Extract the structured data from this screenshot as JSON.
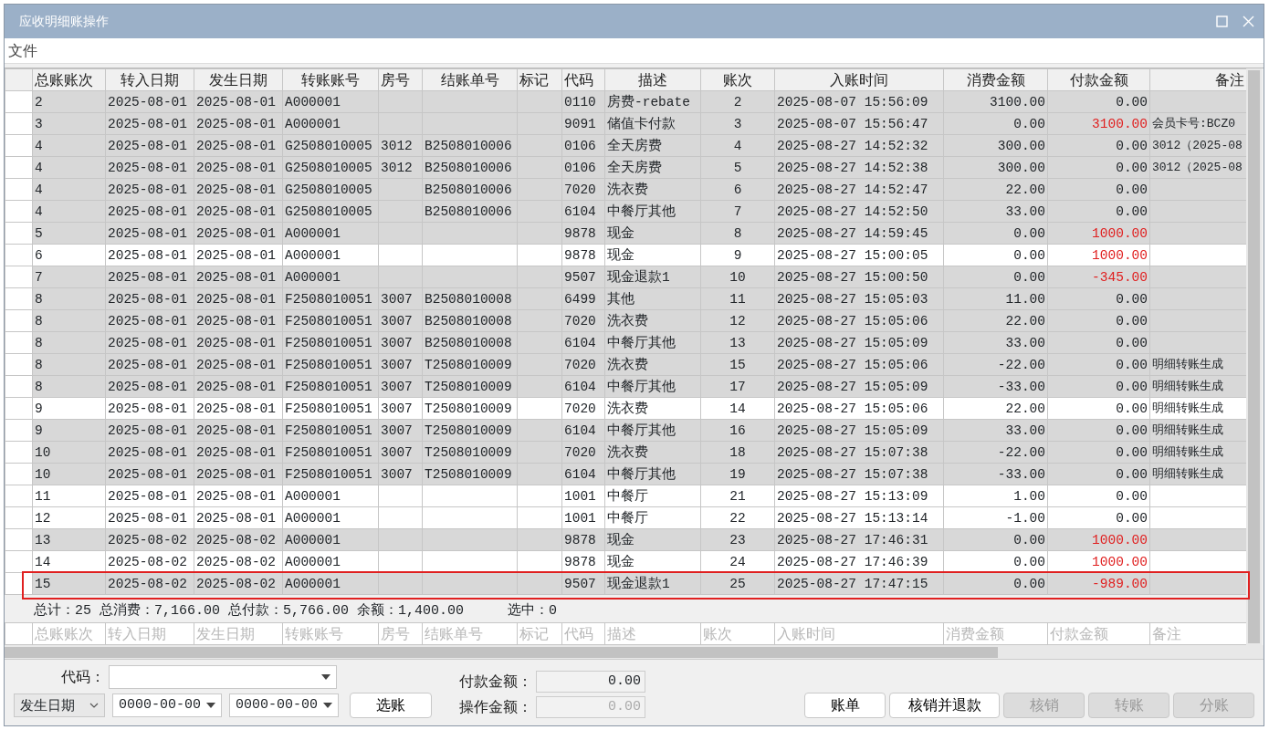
{
  "window": {
    "title": "应收明细账操作"
  },
  "menu": [
    {
      "label": "文件"
    }
  ],
  "table": {
    "columns": [
      {
        "label": "总账账次"
      },
      {
        "label": "转入日期"
      },
      {
        "label": "发生日期"
      },
      {
        "label": "转账账号"
      },
      {
        "label": "房号"
      },
      {
        "label": "结账单号"
      },
      {
        "label": "标记"
      },
      {
        "label": "代码"
      },
      {
        "label": "描述"
      },
      {
        "label": "账次"
      },
      {
        "label": "入账时间"
      },
      {
        "label": "消费金额"
      },
      {
        "label": "付款金额"
      },
      {
        "label": "备注"
      }
    ],
    "rows": [
      {
        "shaded": true,
        "payment_red": false,
        "outlined": false,
        "cells": [
          "2",
          "2025-08-01",
          "2025-08-01",
          "A000001",
          "",
          "",
          "",
          "0110",
          "房费-rebate",
          "2",
          "2025-08-07 15:56:09",
          "3100.00",
          "0.00",
          ""
        ]
      },
      {
        "shaded": true,
        "payment_red": true,
        "outlined": false,
        "cells": [
          "3",
          "2025-08-01",
          "2025-08-01",
          "A000001",
          "",
          "",
          "",
          "9091",
          "储值卡付款",
          "3",
          "2025-08-07 15:56:47",
          "0.00",
          "3100.00",
          "会员卡号:BCZ0"
        ]
      },
      {
        "shaded": true,
        "payment_red": false,
        "outlined": false,
        "cells": [
          "4",
          "2025-08-01",
          "2025-08-01",
          "G2508010005",
          "3012",
          "B2508010006",
          "",
          "0106",
          "全天房费",
          "4",
          "2025-08-27 14:52:32",
          "300.00",
          "0.00",
          "3012（2025-08"
        ]
      },
      {
        "shaded": true,
        "payment_red": false,
        "outlined": false,
        "cells": [
          "4",
          "2025-08-01",
          "2025-08-01",
          "G2508010005",
          "3012",
          "B2508010006",
          "",
          "0106",
          "全天房费",
          "5",
          "2025-08-27 14:52:38",
          "300.00",
          "0.00",
          "3012（2025-08"
        ]
      },
      {
        "shaded": true,
        "payment_red": false,
        "outlined": false,
        "cells": [
          "4",
          "2025-08-01",
          "2025-08-01",
          "G2508010005",
          "",
          "B2508010006",
          "",
          "7020",
          "洗衣费",
          "6",
          "2025-08-27 14:52:47",
          "22.00",
          "0.00",
          ""
        ]
      },
      {
        "shaded": true,
        "payment_red": false,
        "outlined": false,
        "cells": [
          "4",
          "2025-08-01",
          "2025-08-01",
          "G2508010005",
          "",
          "B2508010006",
          "",
          "6104",
          "中餐厅其他",
          "7",
          "2025-08-27 14:52:50",
          "33.00",
          "0.00",
          ""
        ]
      },
      {
        "shaded": true,
        "payment_red": true,
        "outlined": false,
        "cells": [
          "5",
          "2025-08-01",
          "2025-08-01",
          "A000001",
          "",
          "",
          "",
          "9878",
          "现金",
          "8",
          "2025-08-27 14:59:45",
          "0.00",
          "1000.00",
          ""
        ]
      },
      {
        "shaded": false,
        "payment_red": true,
        "outlined": false,
        "cells": [
          "6",
          "2025-08-01",
          "2025-08-01",
          "A000001",
          "",
          "",
          "",
          "9878",
          "现金",
          "9",
          "2025-08-27 15:00:05",
          "0.00",
          "1000.00",
          ""
        ]
      },
      {
        "shaded": true,
        "payment_red": true,
        "outlined": false,
        "cells": [
          "7",
          "2025-08-01",
          "2025-08-01",
          "A000001",
          "",
          "",
          "",
          "9507",
          "现金退款1",
          "10",
          "2025-08-27 15:00:50",
          "0.00",
          "-345.00",
          ""
        ]
      },
      {
        "shaded": true,
        "payment_red": false,
        "outlined": false,
        "cells": [
          "8",
          "2025-08-01",
          "2025-08-01",
          "F2508010051",
          "3007",
          "B2508010008",
          "",
          "6499",
          "其他",
          "11",
          "2025-08-27 15:05:03",
          "11.00",
          "0.00",
          ""
        ]
      },
      {
        "shaded": true,
        "payment_red": false,
        "outlined": false,
        "cells": [
          "8",
          "2025-08-01",
          "2025-08-01",
          "F2508010051",
          "3007",
          "B2508010008",
          "",
          "7020",
          "洗衣费",
          "12",
          "2025-08-27 15:05:06",
          "22.00",
          "0.00",
          ""
        ]
      },
      {
        "shaded": true,
        "payment_red": false,
        "outlined": false,
        "cells": [
          "8",
          "2025-08-01",
          "2025-08-01",
          "F2508010051",
          "3007",
          "B2508010008",
          "",
          "6104",
          "中餐厅其他",
          "13",
          "2025-08-27 15:05:09",
          "33.00",
          "0.00",
          ""
        ]
      },
      {
        "shaded": true,
        "payment_red": false,
        "outlined": false,
        "cells": [
          "8",
          "2025-08-01",
          "2025-08-01",
          "F2508010051",
          "3007",
          "T2508010009",
          "",
          "7020",
          "洗衣费",
          "15",
          "2025-08-27 15:05:06",
          "-22.00",
          "0.00",
          "明细转账生成"
        ]
      },
      {
        "shaded": true,
        "payment_red": false,
        "outlined": false,
        "cells": [
          "8",
          "2025-08-01",
          "2025-08-01",
          "F2508010051",
          "3007",
          "T2508010009",
          "",
          "6104",
          "中餐厅其他",
          "17",
          "2025-08-27 15:05:09",
          "-33.00",
          "0.00",
          "明细转账生成"
        ]
      },
      {
        "shaded": false,
        "payment_red": false,
        "outlined": false,
        "cells": [
          "9",
          "2025-08-01",
          "2025-08-01",
          "F2508010051",
          "3007",
          "T2508010009",
          "",
          "7020",
          "洗衣费",
          "14",
          "2025-08-27 15:05:06",
          "22.00",
          "0.00",
          "明细转账生成"
        ]
      },
      {
        "shaded": true,
        "payment_red": false,
        "outlined": false,
        "cells": [
          "9",
          "2025-08-01",
          "2025-08-01",
          "F2508010051",
          "3007",
          "T2508010009",
          "",
          "6104",
          "中餐厅其他",
          "16",
          "2025-08-27 15:05:09",
          "33.00",
          "0.00",
          "明细转账生成"
        ]
      },
      {
        "shaded": true,
        "payment_red": false,
        "outlined": false,
        "cells": [
          "10",
          "2025-08-01",
          "2025-08-01",
          "F2508010051",
          "3007",
          "T2508010009",
          "",
          "7020",
          "洗衣费",
          "18",
          "2025-08-27 15:07:38",
          "-22.00",
          "0.00",
          "明细转账生成"
        ]
      },
      {
        "shaded": true,
        "payment_red": false,
        "outlined": false,
        "cells": [
          "10",
          "2025-08-01",
          "2025-08-01",
          "F2508010051",
          "3007",
          "T2508010009",
          "",
          "6104",
          "中餐厅其他",
          "19",
          "2025-08-27 15:07:38",
          "-33.00",
          "0.00",
          "明细转账生成"
        ]
      },
      {
        "shaded": false,
        "payment_red": false,
        "outlined": false,
        "cells": [
          "11",
          "2025-08-01",
          "2025-08-01",
          "A000001",
          "",
          "",
          "",
          "1001",
          "中餐厅",
          "21",
          "2025-08-27 15:13:09",
          "1.00",
          "0.00",
          ""
        ]
      },
      {
        "shaded": false,
        "payment_red": false,
        "outlined": false,
        "cells": [
          "12",
          "2025-08-01",
          "2025-08-01",
          "A000001",
          "",
          "",
          "",
          "1001",
          "中餐厅",
          "22",
          "2025-08-27 15:13:14",
          "-1.00",
          "0.00",
          ""
        ]
      },
      {
        "shaded": true,
        "payment_red": true,
        "outlined": false,
        "cells": [
          "13",
          "2025-08-02",
          "2025-08-02",
          "A000001",
          "",
          "",
          "",
          "9878",
          "现金",
          "23",
          "2025-08-27 17:46:31",
          "0.00",
          "1000.00",
          ""
        ]
      },
      {
        "shaded": false,
        "payment_red": true,
        "outlined": false,
        "cells": [
          "14",
          "2025-08-02",
          "2025-08-02",
          "A000001",
          "",
          "",
          "",
          "9878",
          "现金",
          "24",
          "2025-08-27 17:46:39",
          "0.00",
          "1000.00",
          ""
        ]
      },
      {
        "shaded": true,
        "payment_red": true,
        "outlined": true,
        "cells": [
          "15",
          "2025-08-02",
          "2025-08-02",
          "A000001",
          "",
          "",
          "",
          "9507",
          "现金退款1",
          "25",
          "2025-08-27 17:47:15",
          "0.00",
          "-989.00",
          ""
        ]
      }
    ],
    "summary": "总计：25 总消费：7,166.00 总付款：5,766.00 余额：1,400.00",
    "selected_count": "选中：0",
    "filter_row": [
      "总账账次",
      "转入日期",
      "发生日期",
      "转账账号",
      "房号",
      "结账单号",
      "标记",
      "代码",
      "描述",
      "账次",
      "入账时间",
      "消费金额",
      "付款金额",
      "备注"
    ]
  },
  "form": {
    "code_label": "代码：",
    "date_type": "发生日期",
    "date_from": "0000-00-00",
    "date_to": "0000-00-00",
    "select_button": "选账",
    "payment_label": "付款金额：",
    "payment_value": "0.00",
    "operation_label": "操作金额：",
    "operation_value": "0.00"
  },
  "buttons": [
    {
      "label": "账单",
      "disabled": false
    },
    {
      "label": "核销并退款",
      "disabled": false
    },
    {
      "label": "核销",
      "disabled": true
    },
    {
      "label": "转账",
      "disabled": true
    },
    {
      "label": "分账",
      "disabled": true
    }
  ]
}
